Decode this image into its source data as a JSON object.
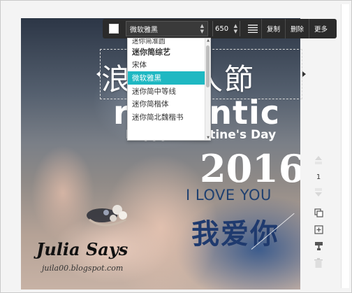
{
  "poster": {
    "festival_text": "浪漫情人節",
    "romantic_text": "romantic",
    "valentines_text": "Happy Valentine's Day",
    "year_text": "2016",
    "love_text": "I LOVE YOU",
    "chinese_love_text": "我爱你",
    "watermark_title": "Julia Says",
    "watermark_url": "juila00.blogspot.com"
  },
  "toolbar": {
    "color_swatch": "#ffffff",
    "font_value": "微软雅黑",
    "size_value": "650",
    "align_icon": "align-justify-icon",
    "copy_label": "复制",
    "delete_label": "删除",
    "more_label": "更多"
  },
  "font_dropdown": {
    "options": [
      {
        "label": "迷你简准圆",
        "style": "partial"
      },
      {
        "label": "迷你简综艺",
        "style": "bold"
      },
      {
        "label": "宋体",
        "style": "serif"
      },
      {
        "label": "微软雅黑",
        "style": "selected"
      },
      {
        "label": "迷你简中等线",
        "style": "normal"
      },
      {
        "label": "迷你简楷体",
        "style": "serif"
      },
      {
        "label": "迷你简北魏楷书",
        "style": "serif"
      }
    ],
    "selected_color": "#1fb8c2"
  },
  "layer_controls": {
    "up_icon": "layer-up-icon",
    "level_value": "1",
    "down_icon": "layer-down-icon",
    "tools": [
      "duplicate-icon",
      "add-page-icon",
      "format-brush-icon",
      "trash-icon"
    ]
  }
}
